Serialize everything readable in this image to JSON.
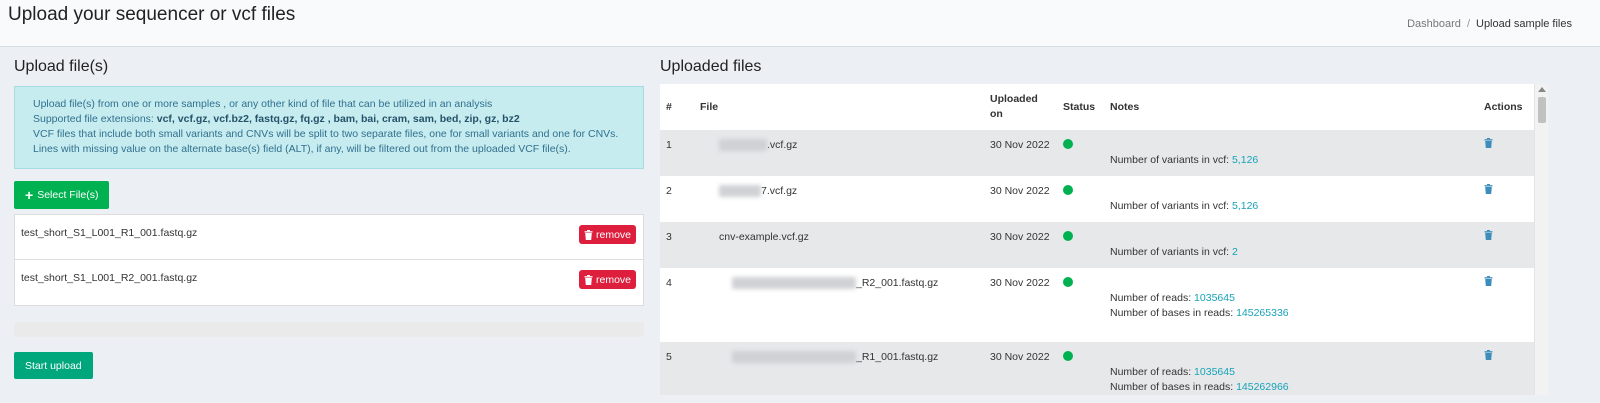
{
  "header": {
    "title": "Upload your sequencer or vcf files",
    "breadcrumb": {
      "home": "Dashboard",
      "separator": "/",
      "current": "Upload sample files"
    }
  },
  "upload": {
    "title": "Upload file(s)",
    "info": {
      "line1": "Upload file(s) from one or more samples , or any other kind of file that can be utilized in an analysis",
      "line2_prefix": "Supported file extensions: ",
      "line2_exts": "vcf, vcf.gz, vcf.bz2, fastq.gz, fq.gz , bam, bai, cram, sam, bed, zip, gz, bz2",
      "line3": "VCF files that include both small variants and CNVs will be split to two separate files, one for small variants and one for CNVs.",
      "line4": "Lines with missing value on the alternate base(s) field (ALT), if any, will be filtered out from the uploaded VCF file(s)."
    },
    "select_label": "Select File(s)",
    "remove_label": "remove",
    "files": [
      {
        "name": "test_short_S1_L001_R1_001.fastq.gz"
      },
      {
        "name": "test_short_S1_L001_R2_001.fastq.gz"
      }
    ],
    "progress_percent": 0,
    "start_label": "Start upload"
  },
  "uploaded": {
    "title": "Uploaded files",
    "columns": {
      "num": "#",
      "file": "File",
      "uploaded_on": "Uploaded on",
      "status": "Status",
      "notes": "Notes",
      "actions": "Actions"
    },
    "rows": [
      {
        "num": "1",
        "file_suffix": ".vcf.gz",
        "date": "30 Nov 2022",
        "notes": [
          {
            "label": "Number of variants in vcf: ",
            "value": "5,126"
          }
        ]
      },
      {
        "num": "2",
        "file_suffix": "7.vcf.gz",
        "date": "30 Nov 2022",
        "notes": [
          {
            "label": "Number of variants in vcf: ",
            "value": "5,126"
          }
        ]
      },
      {
        "num": "3",
        "file_suffix": "cnv-example.vcf.gz",
        "date": "30 Nov 2022",
        "notes": [
          {
            "label": "Number of variants in vcf: ",
            "value": "2"
          }
        ]
      },
      {
        "num": "4",
        "file_suffix": "_R2_001.fastq.gz",
        "date": "30 Nov 2022",
        "notes": [
          {
            "label": "Number of reads: ",
            "value": "1035645"
          },
          {
            "label": "Number of bases in reads: ",
            "value": "145265336"
          }
        ]
      },
      {
        "num": "5",
        "file_suffix": "_R1_001.fastq.gz",
        "date": "30 Nov 2022",
        "notes": [
          {
            "label": "Number of reads: ",
            "value": "1035645"
          },
          {
            "label": "Number of bases in reads: ",
            "value": "145262966"
          }
        ]
      }
    ]
  },
  "colors": {
    "green": "#00b151",
    "teal": "#00a77d",
    "red": "#dd1f3d",
    "info_bg": "#c6ecef",
    "link": "#17a2b8",
    "trash": "#3c8dbc"
  },
  "icons": {
    "plus": "plus-icon",
    "trash": "trash-icon",
    "status": "status-dot-icon"
  }
}
